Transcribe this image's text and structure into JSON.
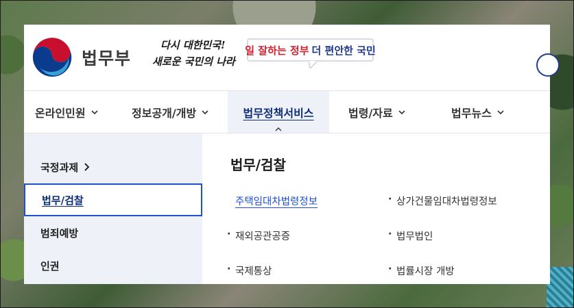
{
  "header": {
    "logo_text": "법무부",
    "slogan_line1": "다시 대한민국!",
    "slogan_line2": "새로운 국민의 나라",
    "campaign": {
      "part1": "일 잘하는 정부",
      "part2": "더 편안한 국민"
    },
    "icons": {
      "emblem": "korea-taegeuk-emblem",
      "search": "search-icon"
    },
    "colors": {
      "accent": "#1d4ed8",
      "campaign_red": "#d61f2c",
      "campaign_blue": "#1f3a8a"
    }
  },
  "nav": {
    "items": [
      {
        "label": "온라인민원",
        "active": false
      },
      {
        "label": "정보공개/개방",
        "active": false
      },
      {
        "label": "법무정책서비스",
        "active": true
      },
      {
        "label": "법령/자료",
        "active": false
      },
      {
        "label": "법무뉴스",
        "active": false
      }
    ]
  },
  "dropdown": {
    "side_items": [
      {
        "label": "국정과제"
      },
      {
        "label": "법무/검찰"
      },
      {
        "label": "범죄예방"
      },
      {
        "label": "인권"
      }
    ],
    "title": "법무/검찰",
    "links": [
      [
        "주택임대차법령정보",
        "상가건물임대차법령정보"
      ],
      [
        "재외공관공증",
        "법무법인"
      ],
      [
        "국제통상",
        "법률시장 개방"
      ]
    ]
  }
}
